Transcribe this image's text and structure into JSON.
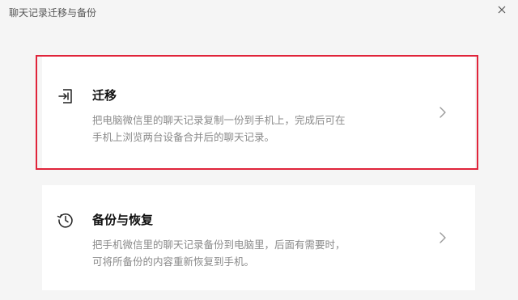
{
  "window": {
    "title": "聊天记录迁移与备份"
  },
  "options": [
    {
      "title": "迁移",
      "description_line1": "把电脑微信里的聊天记录复制一份到手机上，完成后可在",
      "description_line2": "手机上浏览两台设备合并后的聊天记录。",
      "icon": "migrate-icon"
    },
    {
      "title": "备份与恢复",
      "description_line1": "把手机微信里的聊天记录备份到电脑里，后面有需要时，",
      "description_line2": "可将所备份的内容重新恢复到手机。",
      "icon": "history-icon"
    }
  ],
  "colors": {
    "highlight_border": "#e0243a",
    "background": "#f5f5f5",
    "card": "#ffffff",
    "description": "#8a8a8a"
  }
}
